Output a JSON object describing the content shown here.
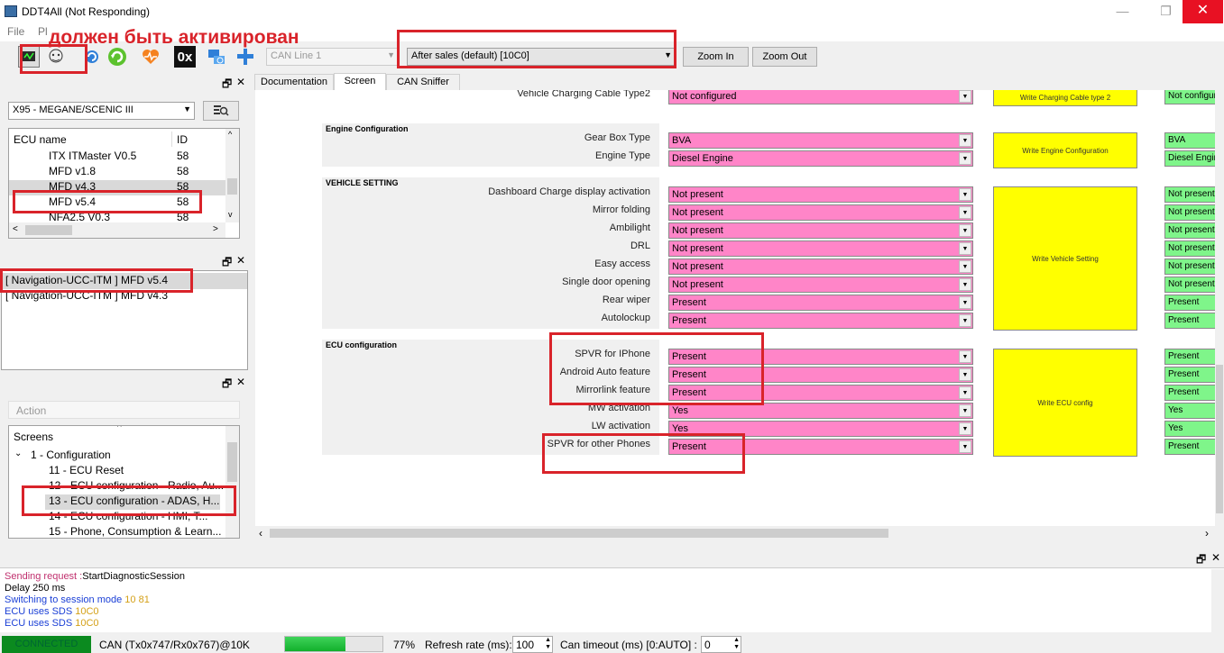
{
  "window": {
    "title": "DDT4All (Not Responding)",
    "minimize": "—",
    "restore": "❐",
    "close": "✕"
  },
  "menu": [
    "File",
    "Pl"
  ],
  "annotation": "должен быть активирован",
  "toolbar": {
    "can_line": "CAN Line 1",
    "session": "After sales (default) [10C0]",
    "zoom_in": "Zoom In",
    "zoom_out": "Zoom Out",
    "hex_label": "0x"
  },
  "ecu_panel": {
    "vehicle": "X95 - MEGANE/SCENIC III",
    "col_name": "ECU name",
    "col_id": "ID",
    "rows": [
      {
        "name": "ITX ITMaster V0.5",
        "id": "58"
      },
      {
        "name": "MFD v1.8",
        "id": "58"
      },
      {
        "name": "MFD v4.3",
        "id": "58"
      },
      {
        "name": "MFD v5.4",
        "id": "58"
      },
      {
        "name": "NFA2.5 V0.3",
        "id": "58"
      }
    ]
  },
  "nav_panel": {
    "items": [
      "[ Navigation-UCC-ITM ] MFD v5.4",
      "[ Navigation-UCC-ITM ] MFD v4.3"
    ]
  },
  "screens_panel": {
    "action": "Action",
    "root": "Screens",
    "group": "1 - Configuration",
    "items": [
      "11 - ECU Reset",
      "12 - ECU configuration - Radio, Au...",
      "13 - ECU configuration - ADAS, H...",
      "14 - ECU configuration - HMI, T...",
      "15 - Phone, Consumption & Learn..."
    ]
  },
  "tabs": [
    "Documentation",
    "Screen",
    "CAN Sniffer"
  ],
  "screen": {
    "top_row": {
      "label": "Vehicle Charging Cable Type2",
      "value": "Not configured",
      "button": "Write Charging Cable type 2",
      "current": "Not configured"
    },
    "engine": {
      "title": "Engine Configuration",
      "button": "Write Engine Configuration",
      "fields": [
        {
          "label": "Gear Box Type",
          "value": "BVA",
          "current": "BVA"
        },
        {
          "label": "Engine Type",
          "value": "Diesel Engine",
          "current": "Diesel Engine"
        }
      ]
    },
    "vehicle": {
      "title": "VEHICLE SETTING",
      "button": "Write Vehicle Setting",
      "fields": [
        {
          "label": "Dashboard Charge display activation",
          "value": "Not present",
          "current": "Not present"
        },
        {
          "label": "Mirror folding",
          "value": "Not present",
          "current": "Not present"
        },
        {
          "label": "Ambilight",
          "value": "Not present",
          "current": "Not present"
        },
        {
          "label": "DRL",
          "value": "Not present",
          "current": "Not present"
        },
        {
          "label": "Easy access",
          "value": "Not present",
          "current": "Not present"
        },
        {
          "label": "Single door opening",
          "value": "Not present",
          "current": "Not present"
        },
        {
          "label": "Rear wiper",
          "value": "Present",
          "current": "Present"
        },
        {
          "label": "Autolockup",
          "value": "Present",
          "current": "Present"
        }
      ]
    },
    "ecu": {
      "title": "ECU configuration",
      "button": "Write ECU config",
      "fields": [
        {
          "label": "SPVR for IPhone",
          "value": "Present",
          "current": "Present"
        },
        {
          "label": "Android Auto feature",
          "value": "Present",
          "current": "Present"
        },
        {
          "label": "Mirrorlink feature",
          "value": "Present",
          "current": "Present"
        },
        {
          "label": "MW activation",
          "value": "Yes",
          "current": "Yes"
        },
        {
          "label": "LW activation",
          "value": "Yes",
          "current": "Yes"
        },
        {
          "label": "SPVR for other Phones",
          "value": "Present",
          "current": "Present"
        }
      ]
    }
  },
  "log": [
    {
      "label": "Sending request :",
      "text": "StartDiagnosticSession",
      "c1": "#c0306e",
      "c2": "#000000"
    },
    {
      "label": "Delay 250 ms",
      "text": "",
      "c1": "#000000",
      "c2": "#000000"
    },
    {
      "label": "Switching to session mode ",
      "text": "10 81",
      "c1": "#1a3fd6",
      "c2": "#d4a017"
    },
    {
      "label": "ECU uses SDS ",
      "text": "10C0",
      "c1": "#1a3fd6",
      "c2": "#d4a017"
    },
    {
      "label": "ECU uses SDS ",
      "text": "10C0",
      "c1": "#1a3fd6",
      "c2": "#d4a017"
    }
  ],
  "status": {
    "connected": "CONNECTED",
    "can": "CAN (Tx0x747/Rx0x767)@10K",
    "progress_pct": 77,
    "progress_label": "77%",
    "refresh_label": "Refresh rate (ms):",
    "refresh_value": "100",
    "timeout_label": "Can timeout (ms) [0:AUTO] :",
    "timeout_value": "0"
  }
}
